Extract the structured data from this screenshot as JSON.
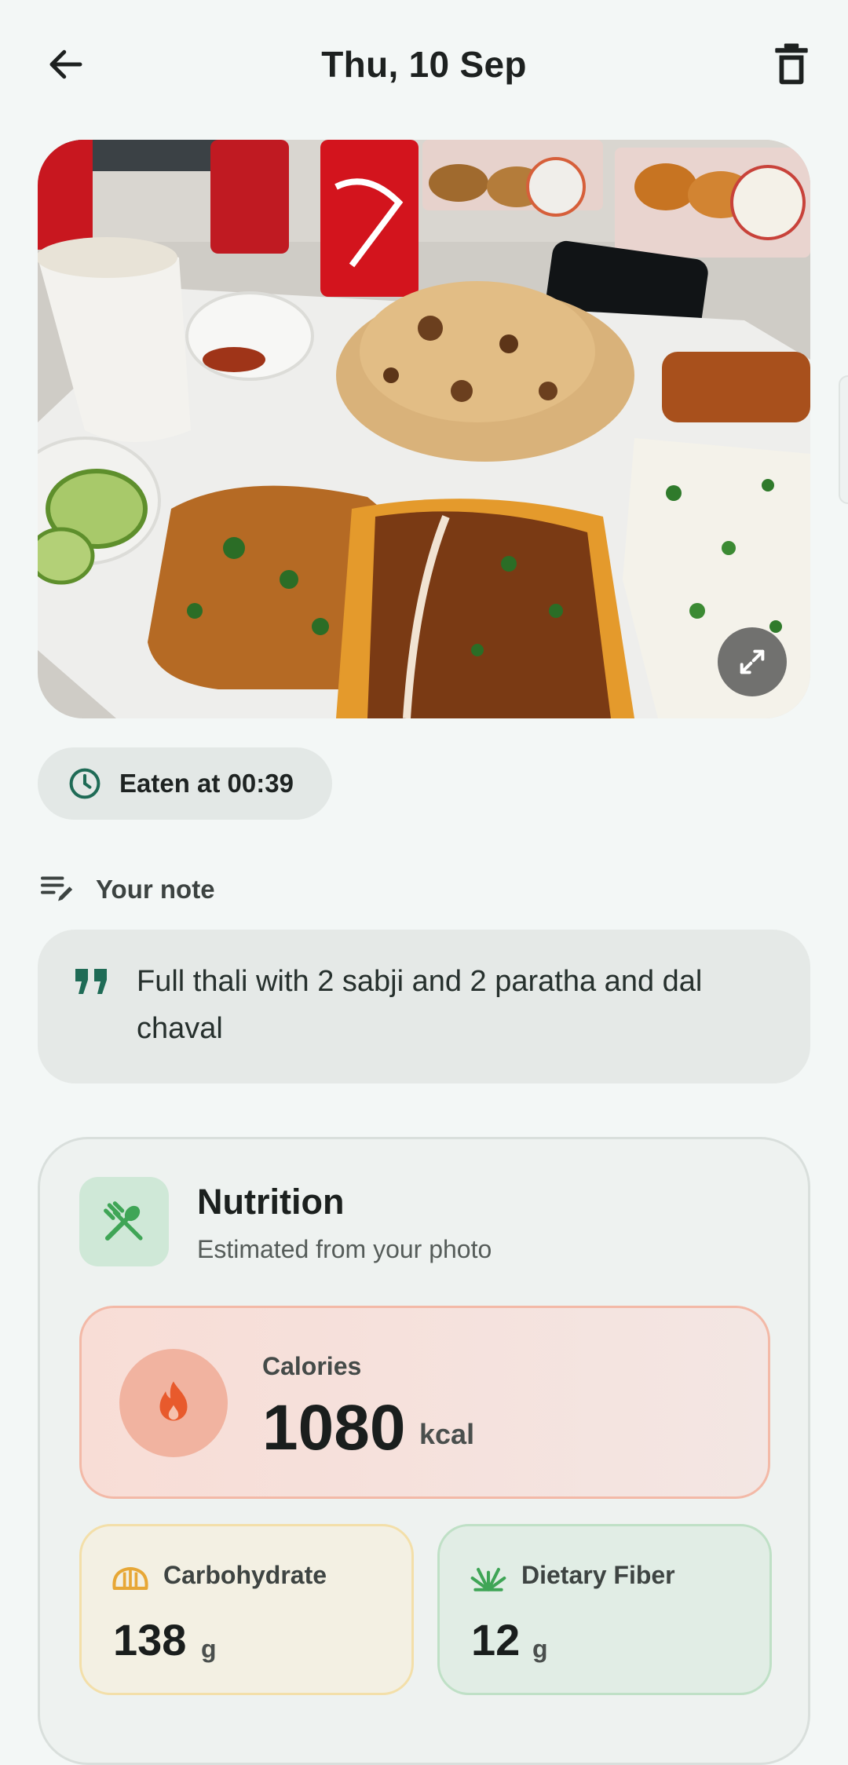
{
  "header": {
    "title": "Thu, 10 Sep",
    "back_icon": "arrow-left-icon",
    "delete_icon": "trash-icon"
  },
  "photo": {
    "expand_icon": "expand-icon"
  },
  "meal_time": {
    "label": "Eaten at 00:39",
    "icon": "clock-icon"
  },
  "note": {
    "heading": "Your note",
    "heading_icon": "edit-note-icon",
    "text": "Full thali with 2 sabji and 2 paratha and dal chaval",
    "quote_icon": "quote-icon"
  },
  "nutrition": {
    "title": "Nutrition",
    "subtitle": "Estimated from your photo",
    "icon": "fork-knife-icon",
    "calories": {
      "label": "Calories",
      "value": "1080",
      "unit": "kcal",
      "icon": "flame-icon"
    },
    "carbohydrate": {
      "label": "Carbohydrate",
      "value": "138",
      "unit": "g",
      "icon": "bread-icon"
    },
    "fiber": {
      "label": "Dietary Fiber",
      "value": "12",
      "unit": "g",
      "icon": "grass-icon"
    }
  },
  "colors": {
    "accent_green": "#1f6b56",
    "calorie_orange": "#e85a2c",
    "carb_yellow": "#e7a736",
    "fiber_green": "#3fa556"
  }
}
